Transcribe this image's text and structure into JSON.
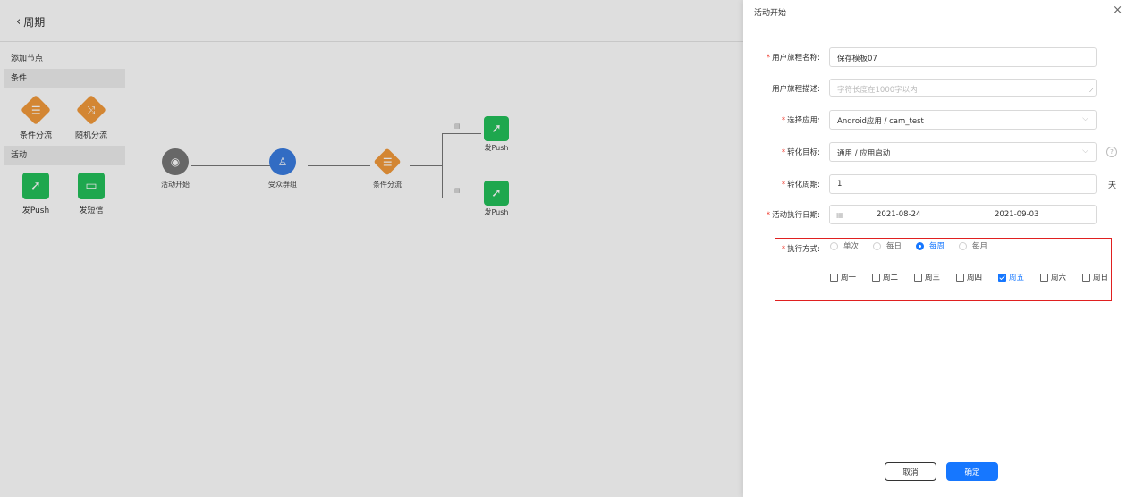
{
  "header": {
    "back_label": "周期"
  },
  "panel": {
    "title": "添加节点",
    "groups": [
      {
        "label": "条件",
        "items": [
          {
            "label": "条件分流",
            "icon": "list-icon"
          },
          {
            "label": "随机分流",
            "icon": "shuffle-icon"
          }
        ]
      },
      {
        "label": "活动",
        "items": [
          {
            "label": "发Push",
            "icon": "rocket-icon"
          },
          {
            "label": "发短信",
            "icon": "message-icon"
          }
        ]
      }
    ]
  },
  "flow": {
    "nodes": [
      {
        "label": "活动开始",
        "icon": "start-icon"
      },
      {
        "label": "受众群组",
        "icon": "user-group-icon"
      },
      {
        "label": "条件分流",
        "icon": "list-icon"
      },
      {
        "label": "发Push",
        "icon": "rocket-icon"
      },
      {
        "label": "发Push",
        "icon": "rocket-icon"
      }
    ]
  },
  "drawer": {
    "title": "活动开始",
    "fields": {
      "journey_name": {
        "label": "用户旅程名称:",
        "value": "保存模板07"
      },
      "journey_desc": {
        "label": "用户旅程描述:",
        "placeholder": "字符长度在1000字以内"
      },
      "app": {
        "label": "选择应用:",
        "value": "Android应用 / cam_test"
      },
      "target": {
        "label": "转化目标:",
        "value": "通用 / 应用启动"
      },
      "period": {
        "label": "转化周期:",
        "value": "1",
        "unit": "天"
      },
      "exec_date": {
        "label": "活动执行日期:",
        "start": "2021-08-24",
        "end": "2021-09-03"
      },
      "exec_mode": {
        "label": "执行方式:",
        "options": [
          "单次",
          "每日",
          "每周",
          "每月"
        ],
        "selected": "每周",
        "weekdays": [
          "周一",
          "周二",
          "周三",
          "周四",
          "周五",
          "周六",
          "周日"
        ],
        "checked": [
          "周五"
        ]
      }
    },
    "buttons": {
      "cancel": "取消",
      "ok": "确定"
    }
  },
  "colors": {
    "accent": "#1677ff",
    "condition": "#f39a3b",
    "activity": "#23c05a",
    "audience": "#3a7de0",
    "required": "#f04134"
  }
}
